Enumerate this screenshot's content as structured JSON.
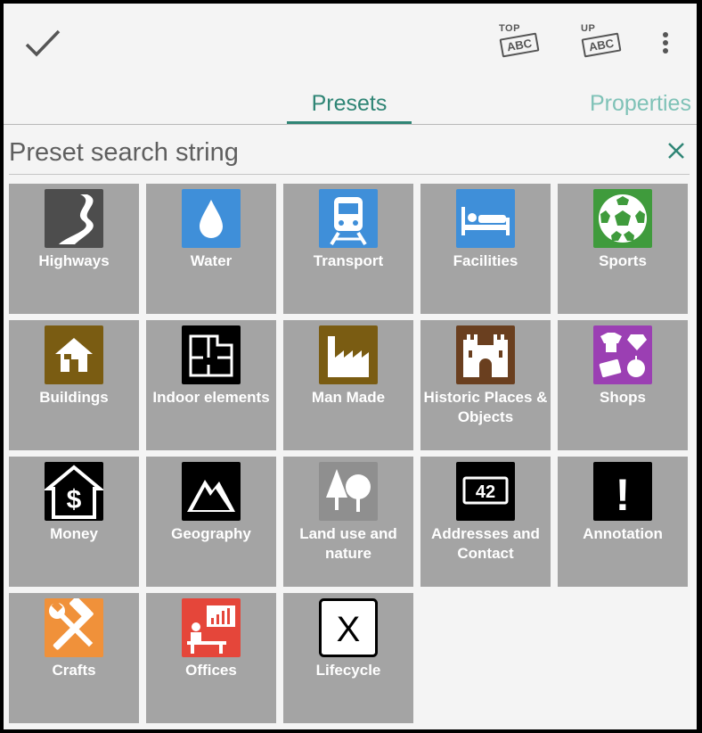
{
  "toolbar": {
    "confirm_icon": "checkmark-icon",
    "top_label": "TOP",
    "top_abc": "ABC",
    "up_label": "UP",
    "up_abc": "ABC",
    "overflow_icon": "more-vert-icon"
  },
  "tabs": [
    {
      "label": "Presets",
      "active": true
    },
    {
      "label": "Properties",
      "active": false
    }
  ],
  "search": {
    "placeholder": "Preset search string",
    "value": "",
    "clear_icon": "close-icon"
  },
  "colors": {
    "accent": "#2f8575",
    "accent_light": "#7fc2b7",
    "tile_bg": "#a4a4a4"
  },
  "presets": [
    {
      "label": "Highways",
      "icon": "highway-icon",
      "color": "#4d4d4d"
    },
    {
      "label": "Water",
      "icon": "water-drop-icon",
      "color": "#3f8fd9"
    },
    {
      "label": "Transport",
      "icon": "train-icon",
      "color": "#3f8fd9"
    },
    {
      "label": "Facilities",
      "icon": "bed-icon",
      "color": "#3f8fd9"
    },
    {
      "label": "Sports",
      "icon": "soccer-ball-icon",
      "color": "#3f9b3c"
    },
    {
      "label": "Buildings",
      "icon": "house-icon",
      "color": "#7a5c12"
    },
    {
      "label": "Indoor elements",
      "icon": "floorplan-icon",
      "color": "#000000"
    },
    {
      "label": "Man Made",
      "icon": "factory-icon",
      "color": "#7a5c12"
    },
    {
      "label": "Historic Places & Objects",
      "icon": "castle-icon",
      "color": "#6a3f1f"
    },
    {
      "label": "Shops",
      "icon": "shopping-icon",
      "color": "#9b3fb3"
    },
    {
      "label": "Money",
      "icon": "money-house-icon",
      "color": "#000000"
    },
    {
      "label": "Geography",
      "icon": "mountain-icon",
      "color": "#000000"
    },
    {
      "label": "Land use and nature",
      "icon": "trees-icon",
      "color": "#8f8f8f"
    },
    {
      "label": "Addresses and Contact",
      "icon": "house-number-icon",
      "color": "#000000",
      "text": "42"
    },
    {
      "label": "Annotation",
      "icon": "exclamation-icon",
      "color": "#000000",
      "text": "!"
    },
    {
      "label": "Crafts",
      "icon": "tools-icon",
      "color": "#f0913a"
    },
    {
      "label": "Offices",
      "icon": "office-icon",
      "color": "#e5463a"
    },
    {
      "label": "Lifecycle",
      "icon": "lifecycle-x-icon",
      "color": "#ffffff",
      "text": "X"
    }
  ]
}
